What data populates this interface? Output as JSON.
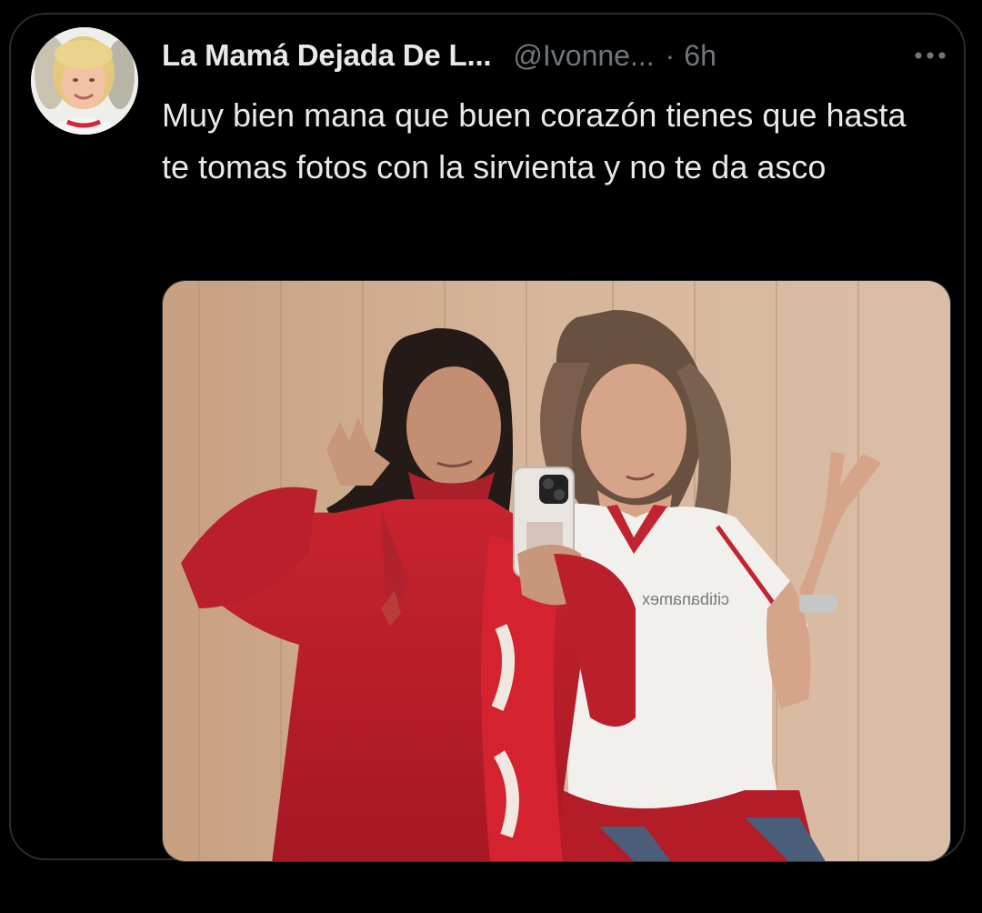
{
  "tweet": {
    "display_name": "La Mamá Dejada De L...",
    "handle": "@Ivonne...",
    "separator": "·",
    "time": "6h",
    "more_icon": "more-horizontal-icon",
    "text": "Muy bien mana que buen corazón tienes que hasta te tomas fotos con la sirvienta y no te da asco",
    "media": {
      "description_icon": "photo",
      "shirt_text": "citibanamex"
    }
  },
  "colors": {
    "background": "#000000",
    "text_primary": "#e7e9ea",
    "text_secondary": "#71767b",
    "border": "#2f3336"
  }
}
